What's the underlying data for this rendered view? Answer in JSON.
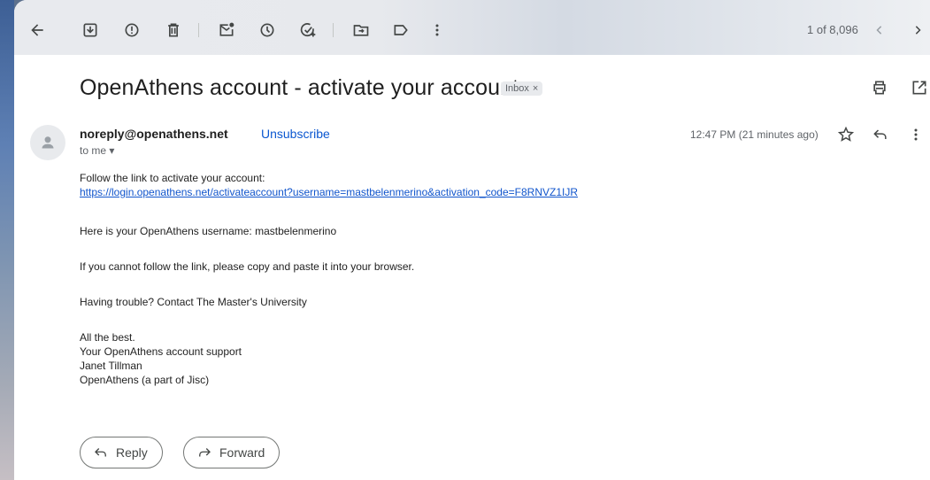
{
  "toolbar": {
    "pager": "1 of 8,096"
  },
  "email": {
    "subject": "OpenAthens account - activate your account",
    "label": "Inbox",
    "label_close": "×",
    "sender": "noreply@openathens.net",
    "unsubscribe": "Unsubscribe",
    "to_me": "to me ▾",
    "time": "12:47 PM (21 minutes ago)",
    "body": {
      "line1": "Follow the link to activate your account:",
      "link": "https://login.openathens.net/activateaccount?username=mastbelenmerino&activation_code=F8RNVZ1IJR",
      "line2": "Here is your OpenAthens username: mastbelenmerino",
      "line3": "If you cannot follow the link, please copy and paste it into your browser.",
      "line4": "Having trouble? Contact The Master's University",
      "sign1": "All the best.",
      "sign2": "Your OpenAthens account support",
      "sign3": "Janet Tillman",
      "sign4": "OpenAthens (a part of Jisc)"
    }
  },
  "actions": {
    "reply": "Reply",
    "forward": "Forward"
  },
  "icons": {
    "back": "arrow-left-icon",
    "archive": "archive-icon",
    "report": "report-spam-icon",
    "delete": "trash-icon",
    "mark_unread": "mark-unread-icon",
    "snooze": "clock-icon",
    "add_task": "add-task-icon",
    "move": "move-to-icon",
    "label": "label-icon",
    "more": "more-vert-icon",
    "prev": "chevron-left-icon",
    "next": "chevron-right-icon",
    "print": "print-icon",
    "new_window": "open-in-new-icon",
    "star": "star-icon",
    "reply": "reply-icon",
    "forward": "forward-icon",
    "avatar": "person-icon"
  }
}
